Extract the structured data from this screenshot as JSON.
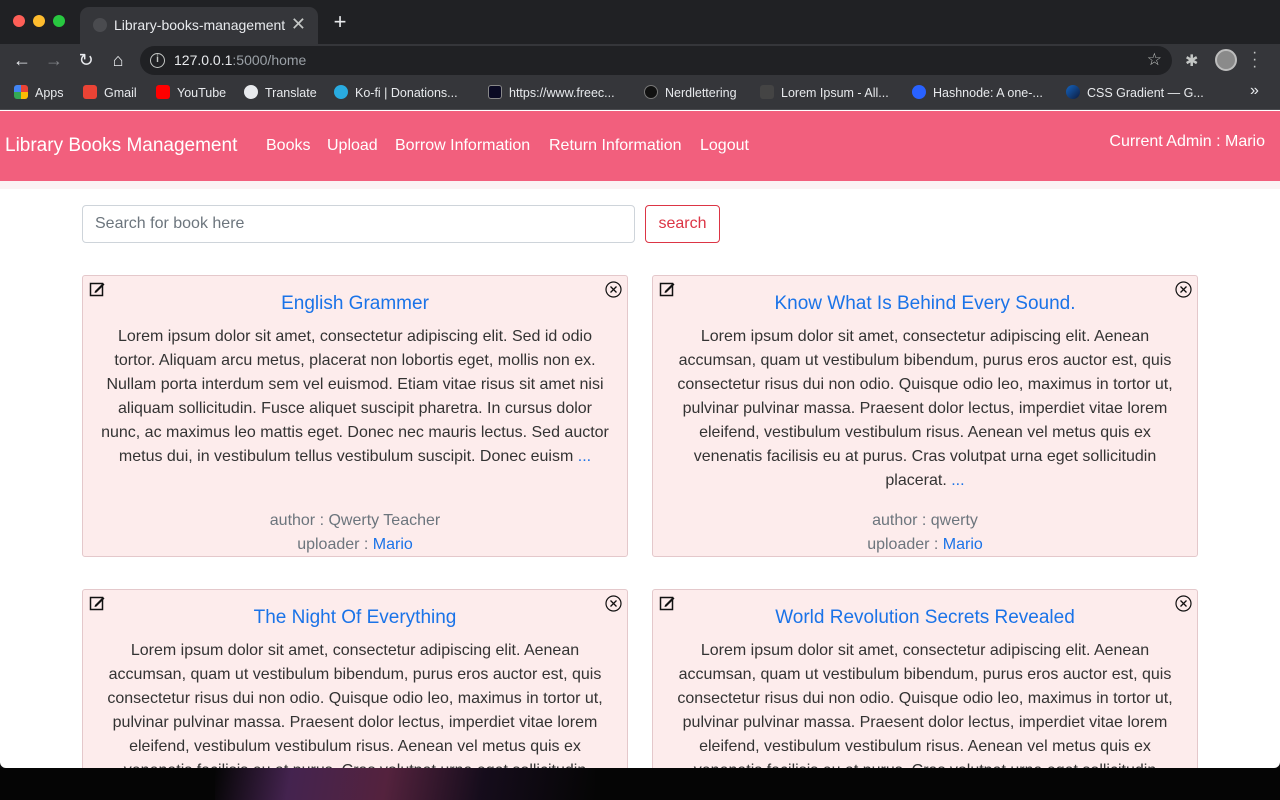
{
  "browser": {
    "tab_title": "Library-books-management",
    "url_host": "127.0.0.1",
    "url_rest": ":5000/home",
    "bookmarks": [
      {
        "label": "Apps",
        "color": "#4285f4"
      },
      {
        "label": "Gmail",
        "color": "#ea4335"
      },
      {
        "label": "YouTube",
        "color": "#ff0000"
      },
      {
        "label": "Translate",
        "color": "#e8eaed"
      },
      {
        "label": "Ko-fi | Donations...",
        "color": "#29abe0"
      },
      {
        "label": "https://www.freec...",
        "color": "#0a0a23"
      },
      {
        "label": "Nerdlettering",
        "color": "#111111"
      },
      {
        "label": "Lorem Ipsum - All...",
        "color": "#444444"
      },
      {
        "label": "Hashnode: A one-...",
        "color": "#2962ff"
      },
      {
        "label": "CSS Gradient — G...",
        "color": "#1565c0"
      }
    ]
  },
  "navbar": {
    "brand": "Library Books Management",
    "links": [
      "Books",
      "Upload",
      "Borrow Information",
      "Return Information",
      "Logout"
    ],
    "admin": "Current Admin : Mario",
    "color": "#f25f7d"
  },
  "search": {
    "placeholder": "Search for book here",
    "button": "search"
  },
  "books": [
    {
      "title": "English Grammer",
      "description": "Lorem ipsum dolor sit amet, consectetur adipiscing elit. Sed id odio tortor. Aliquam arcu metus, placerat non lobortis eget, mollis non ex. Nullam porta interdum sem vel euismod. Etiam vitae risus sit amet nisi aliquam sollicitudin. Fusce aliquet suscipit pharetra. In cursus dolor nunc, ac maximus leo mattis eget. Donec nec mauris lectus. Sed auctor metus dui, in vestibulum tellus vestibulum suscipit. Donec euism",
      "more": "...",
      "author": "author : Qwerty Teacher",
      "uploader_label": "uploader : ",
      "uploader": "Mario"
    },
    {
      "title": "Know What Is Behind Every Sound.",
      "description": "Lorem ipsum dolor sit amet, consectetur adipiscing elit. Aenean accumsan, quam ut vestibulum bibendum, purus eros auctor est, quis consectetur risus dui non odio. Quisque odio leo, maximus in tortor ut, pulvinar pulvinar massa. Praesent dolor lectus, imperdiet vitae lorem eleifend, vestibulum vestibulum risus. Aenean vel metus quis ex venenatis facilisis eu at purus. Cras volutpat urna eget sollicitudin placerat.",
      "more": "...",
      "author": "author : qwerty",
      "uploader_label": "uploader : ",
      "uploader": "Mario"
    },
    {
      "title": "The Night Of Everything",
      "description": "Lorem ipsum dolor sit amet, consectetur adipiscing elit. Aenean accumsan, quam ut vestibulum bibendum, purus eros auctor est, quis consectetur risus dui non odio. Quisque odio leo, maximus in tortor ut, pulvinar pulvinar massa. Praesent dolor lectus, imperdiet vitae lorem eleifend, vestibulum vestibulum risus. Aenean vel metus quis ex venenatis facilisis eu at purus. Cras volutpat urna eget sollicitudin",
      "more": "",
      "author": "",
      "uploader_label": "",
      "uploader": ""
    },
    {
      "title": "World Revolution Secrets Revealed",
      "description": "Lorem ipsum dolor sit amet, consectetur adipiscing elit. Aenean accumsan, quam ut vestibulum bibendum, purus eros auctor est, quis consectetur risus dui non odio. Quisque odio leo, maximus in tortor ut, pulvinar pulvinar massa. Praesent dolor lectus, imperdiet vitae lorem eleifend, vestibulum vestibulum risus. Aenean vel metus quis ex venenatis facilisis eu at purus. Cras volutpat urna eget sollicitudin",
      "more": "",
      "author": "",
      "uploader_label": "",
      "uploader": ""
    }
  ]
}
